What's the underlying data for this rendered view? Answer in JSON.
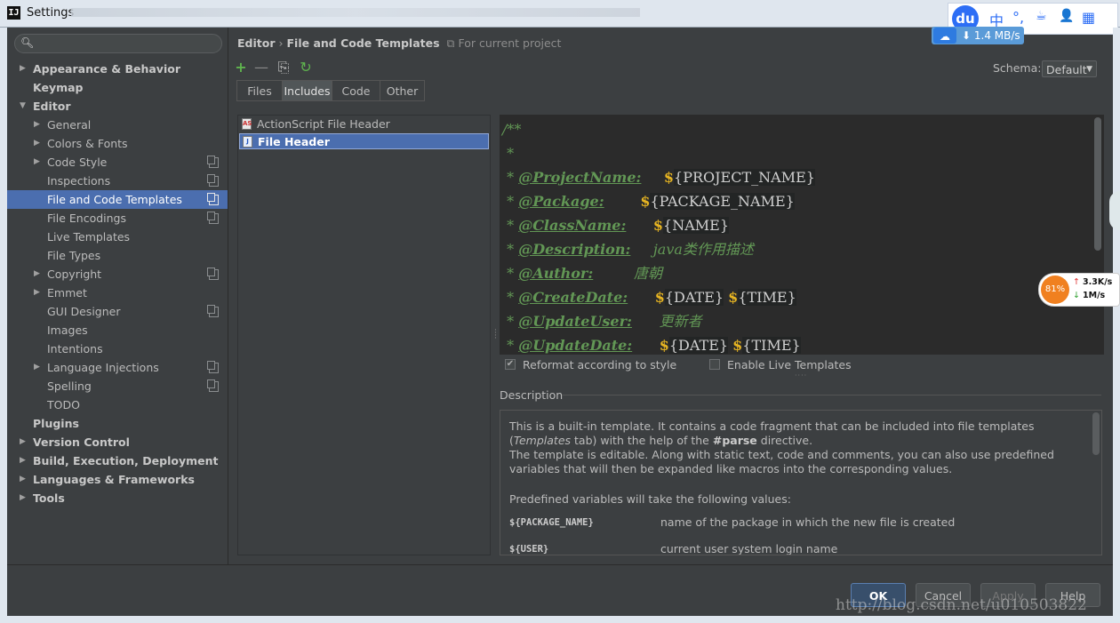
{
  "window": {
    "title": "Settings",
    "app_icon": "IJ",
    "min": "—",
    "max": "☐",
    "close": "✕"
  },
  "ime": {
    "logo": "du",
    "icon_chars": [
      "中",
      "°,",
      "☕",
      "👤",
      "▦"
    ]
  },
  "net_pill": {
    "speed": "1.4 MB/s"
  },
  "gauge": {
    "percent": "81%",
    "upload": "3.3K/s",
    "download": "1M/s"
  },
  "search": {
    "placeholder": ""
  },
  "sidebar": {
    "items": [
      {
        "label": "Appearance & Behavior",
        "level": 0,
        "arrow": "right",
        "bold": true
      },
      {
        "label": "Keymap",
        "level": 0,
        "arrow": "",
        "bold": true
      },
      {
        "label": "Editor",
        "level": 0,
        "arrow": "down",
        "bold": true
      },
      {
        "label": "General",
        "level": 1,
        "arrow": "right"
      },
      {
        "label": "Colors & Fonts",
        "level": 1,
        "arrow": "right"
      },
      {
        "label": "Code Style",
        "level": 1,
        "arrow": "right",
        "project": true
      },
      {
        "label": "Inspections",
        "level": 1,
        "arrow": "",
        "project": true
      },
      {
        "label": "File and Code Templates",
        "level": 1,
        "arrow": "",
        "project": true,
        "selected": true
      },
      {
        "label": "File Encodings",
        "level": 1,
        "arrow": "",
        "project": true
      },
      {
        "label": "Live Templates",
        "level": 1,
        "arrow": ""
      },
      {
        "label": "File Types",
        "level": 1,
        "arrow": ""
      },
      {
        "label": "Copyright",
        "level": 1,
        "arrow": "right",
        "project": true
      },
      {
        "label": "Emmet",
        "level": 1,
        "arrow": "right"
      },
      {
        "label": "GUI Designer",
        "level": 1,
        "arrow": "",
        "project": true
      },
      {
        "label": "Images",
        "level": 1,
        "arrow": ""
      },
      {
        "label": "Intentions",
        "level": 1,
        "arrow": ""
      },
      {
        "label": "Language Injections",
        "level": 1,
        "arrow": "right",
        "project": true
      },
      {
        "label": "Spelling",
        "level": 1,
        "arrow": "",
        "project": true
      },
      {
        "label": "TODO",
        "level": 1,
        "arrow": ""
      },
      {
        "label": "Plugins",
        "level": 0,
        "arrow": "",
        "bold": true
      },
      {
        "label": "Version Control",
        "level": 0,
        "arrow": "right",
        "bold": true
      },
      {
        "label": "Build, Execution, Deployment",
        "level": 0,
        "arrow": "right",
        "bold": true
      },
      {
        "label": "Languages & Frameworks",
        "level": 0,
        "arrow": "right",
        "bold": true
      },
      {
        "label": "Tools",
        "level": 0,
        "arrow": "right",
        "bold": true
      }
    ]
  },
  "breadcrumb": {
    "part1": "Editor",
    "sep": "›",
    "part2": "File and Code Templates",
    "scope": "For current project"
  },
  "schema": {
    "label": "Schema:",
    "value": "Default"
  },
  "toolbar": {
    "add": "+",
    "remove": "—",
    "copy": "⎘",
    "reset": "↻"
  },
  "tabs": [
    {
      "label": "Files",
      "active": false
    },
    {
      "label": "Includes",
      "active": true
    },
    {
      "label": "Code",
      "active": false
    },
    {
      "label": "Other",
      "active": false
    }
  ],
  "templates": [
    {
      "label": "ActionScript File Header",
      "icon": "AS",
      "selected": false
    },
    {
      "label": "File Header",
      "icon": "J",
      "selected": true
    }
  ],
  "code": {
    "open": "/**",
    "star": " *",
    "lines": [
      {
        "tag": "@ProjectName:",
        "gap": "     ",
        "vars": [
          "PROJECT_NAME"
        ]
      },
      {
        "tag": "@Package:",
        "gap": "        ",
        "vars": [
          "PACKAGE_NAME"
        ]
      },
      {
        "tag": "@ClassName:",
        "gap": "      ",
        "vars": [
          "NAME"
        ]
      },
      {
        "tag": "@Description:",
        "gap": "     ",
        "text": "java类作用描述"
      },
      {
        "tag": "@Author:",
        "gap": "         ",
        "text": "唐朝"
      },
      {
        "tag": "@CreateDate:",
        "gap": "      ",
        "vars": [
          "DATE",
          "TIME"
        ]
      },
      {
        "tag": "@UpdateUser:",
        "gap": "      ",
        "text": "更新者"
      },
      {
        "tag": "@UpdateDate:",
        "gap": "      ",
        "vars": [
          "DATE",
          "TIME"
        ]
      }
    ]
  },
  "options": {
    "reformat": "Reformat according to style",
    "reformat_checked": true,
    "live": "Enable Live Templates",
    "live_checked": false
  },
  "description": {
    "label": "Description",
    "p1a": "This is a built-in template. It contains a code fragment that can be included into file templates",
    "p1b_italic": "Templates",
    "p1b_rest": " tab) with the help of the ",
    "p1b_bold": "#parse",
    "p1b_end": " directive.",
    "p2a": "The template is editable. Along with static text, code and comments, you can also use predefined",
    "p2b": "variables that will then be expanded like macros into the corresponding values.",
    "p3": "Predefined variables will take the following values:",
    "vars": [
      {
        "name": "${PACKAGE_NAME}",
        "desc": "name of the package in which the new file is created"
      },
      {
        "name": "${USER}",
        "desc": "current user system login name"
      }
    ]
  },
  "buttons": {
    "ok": "OK",
    "cancel": "Cancel",
    "apply": "Apply",
    "help": "Help"
  },
  "watermark": "http://blog.csdn.net/u010503822",
  "colors": {
    "accent": "#4b6eaf",
    "background": "#3c3f41",
    "editor_bg": "#2b2b2b",
    "comment": "#629755",
    "dollar": "#e6b422"
  }
}
